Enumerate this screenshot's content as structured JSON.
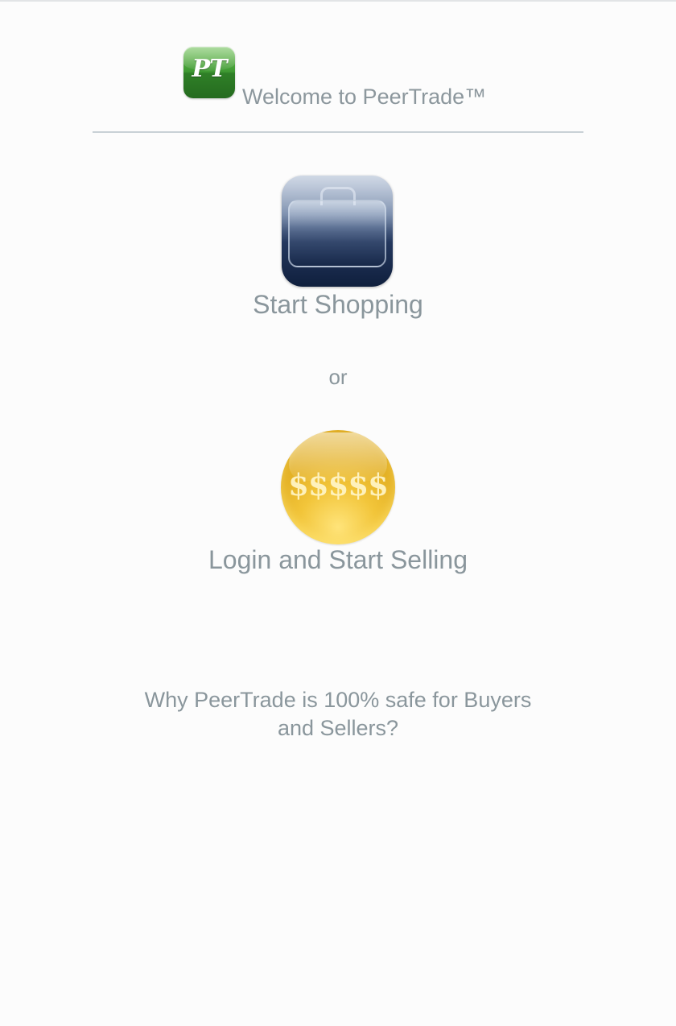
{
  "header": {
    "logo_text": "PT",
    "welcome_text": "Welcome to PeerTrade™"
  },
  "shopping": {
    "icon": "briefcase-icon",
    "label": "Start Shopping"
  },
  "separator_text": "or",
  "selling": {
    "icon": "coin-icon",
    "icon_text": "$$$$$",
    "label": "Login and Start Selling"
  },
  "safety_link": {
    "label": "Why PeerTrade is 100% safe for Buyers and Sellers?"
  },
  "colors": {
    "text": "#8a969c",
    "logo_green": "#3f9a33",
    "briefcase_navy": "#1a2c50",
    "coin_gold": "#e5b226",
    "background": "#fcfcfc"
  }
}
